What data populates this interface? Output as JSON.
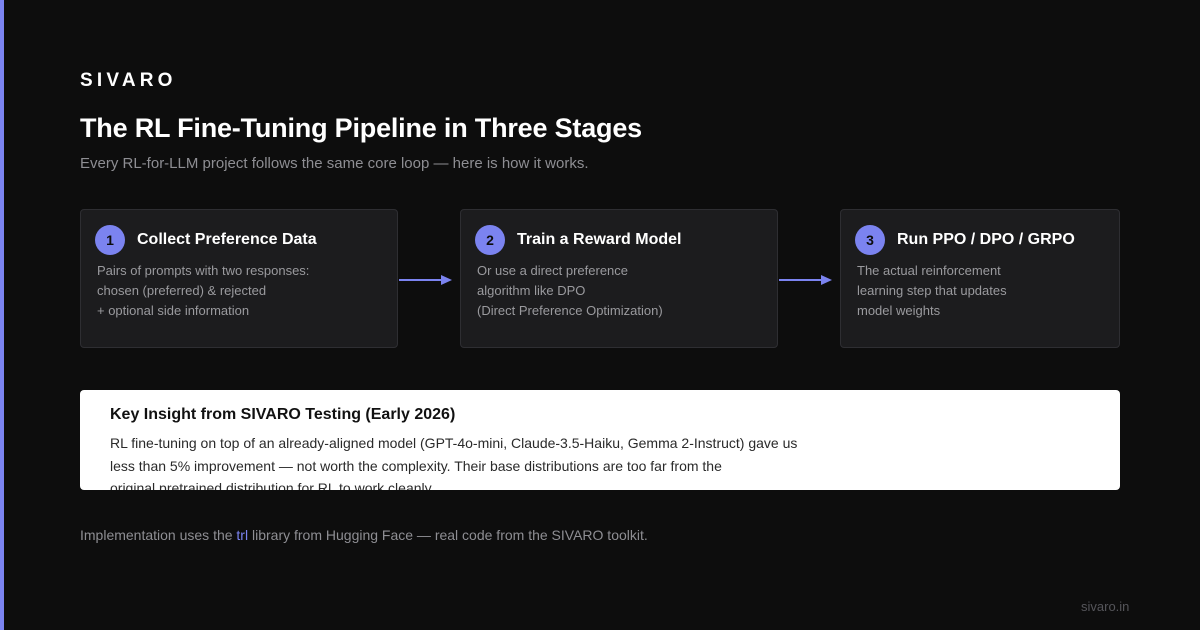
{
  "brand": "SIVARO",
  "title": "The RL Fine-Tuning Pipeline in Three Stages",
  "subtitle": "Every RL-for-LLM project follows the same core loop — here is how it works.",
  "colors": {
    "background": "#0d0d0d",
    "accent": "#7b83f0",
    "card": "#1c1c1e",
    "muted_text": "#9a9a9e"
  },
  "stages": [
    {
      "number": "1",
      "title": "Collect Preference Data",
      "lines": [
        "Pairs of prompts with two responses:",
        "chosen (preferred) & rejected",
        "+ optional side information"
      ]
    },
    {
      "number": "2",
      "title": "Train a Reward Model",
      "lines": [
        "Or use a direct preference",
        "algorithm like DPO",
        "(Direct Preference Optimization)"
      ]
    },
    {
      "number": "3",
      "title": "Run PPO / DPO / GRPO",
      "lines": [
        "The actual reinforcement",
        "learning step that updates",
        "model weights"
      ]
    }
  ],
  "arrow_icons": [
    "arrow-right-icon",
    "arrow-right-icon"
  ],
  "insight": {
    "title": "Key Insight from SIVARO Testing (Early 2026)",
    "lines": [
      "RL fine-tuning on top of an already-aligned model (GPT-4o-mini, Claude-3.5-Haiku, Gemma 2-Instruct) gave us",
      "less than 5% improvement — not worth the complexity. Their base distributions are too far from the",
      "original pretrained distribution for RL to work cleanly."
    ]
  },
  "footer": {
    "prefix": "Implementation uses the ",
    "library": "trl",
    "suffix": " library from Hugging Face — real code from the SIVARO toolkit."
  },
  "site": "sivaro.in"
}
